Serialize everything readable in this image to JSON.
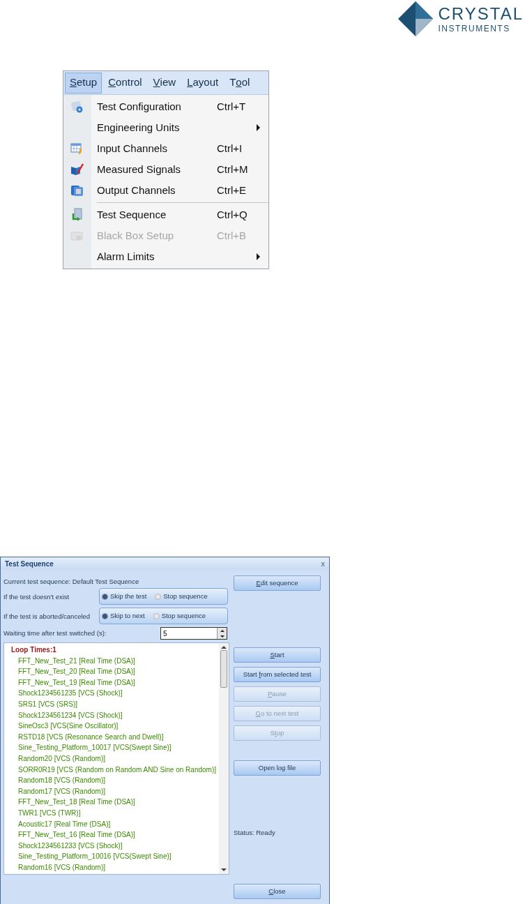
{
  "logo": {
    "line_1": "CRYSTAL",
    "line_2": "INSTRUMENTS"
  },
  "menu": {
    "bar": [
      {
        "label": {
          "key": "S",
          "after": "etup"
        },
        "selected": true
      },
      {
        "label": {
          "key": "C",
          "after": "ontrol"
        },
        "selected": false
      },
      {
        "label": {
          "key": "V",
          "after": "iew"
        },
        "selected": false
      },
      {
        "label": {
          "key": "L",
          "after": "ayout"
        },
        "selected": false
      },
      {
        "label": {
          "before": "T",
          "key": "o",
          "after": "ol"
        },
        "selected": false
      }
    ],
    "items": [
      {
        "label": "Test Configuration",
        "shortcut": "Ctrl+T",
        "submenu": false,
        "disabled": false
      },
      {
        "label": "Engineering Units",
        "submenu": true,
        "disabled": false
      },
      {
        "label": "Input Channels",
        "shortcut": "Ctrl+I",
        "submenu": false,
        "disabled": false
      },
      {
        "label": "Measured Signals",
        "shortcut": "Ctrl+M",
        "submenu": false,
        "disabled": false
      },
      {
        "label": "Output Channels",
        "shortcut": "Ctrl+E",
        "submenu": false,
        "disabled": false,
        "separator_after": true
      },
      {
        "label": "Test Sequence",
        "shortcut": "Ctrl+Q",
        "submenu": false,
        "disabled": false
      },
      {
        "label": "Black Box Setup",
        "shortcut": "Ctrl+B",
        "submenu": false,
        "disabled": true
      },
      {
        "label": "Alarm Limits",
        "submenu": true,
        "disabled": false
      }
    ]
  },
  "dialog": {
    "title": "Test Sequence",
    "close": "x",
    "current": "Current test sequence: Default Test Sequence",
    "options": [
      {
        "label": "If the test doesn't exist",
        "choices": [
          {
            "label": "Skip the test",
            "selected": true
          },
          {
            "label": "Stop sequence",
            "selected": false
          }
        ]
      },
      {
        "label": "If the test is aborted/canceled",
        "choices": [
          {
            "label": "Skip to next",
            "selected": true
          },
          {
            "label": "Stop sequence",
            "selected": false
          }
        ]
      }
    ],
    "waiting": {
      "label": "Waiting time after test switched (s):",
      "value": "5"
    },
    "list": [
      {
        "kind": "header",
        "text": "Loop Times:1"
      },
      {
        "kind": "test",
        "text": "FFT_New_Test_21 [Real Time (DSA)]"
      },
      {
        "kind": "test",
        "text": "FFT_New_Test_20 [Real Time (DSA)]"
      },
      {
        "kind": "test",
        "text": "FFT_New_Test_19 [Real Time (DSA)]"
      },
      {
        "kind": "test",
        "text": "Shock1234561235 [VCS (Shock)]"
      },
      {
        "kind": "test",
        "text": "SRS1 [VCS (SRS)]"
      },
      {
        "kind": "test",
        "text": "Shock1234561234 [VCS (Shock)]"
      },
      {
        "kind": "test",
        "text": "SineOsc3 [VCS(Sine Oscillator)]"
      },
      {
        "kind": "test",
        "text": "RSTD18 [VCS (Resonance Search and Dwell)]"
      },
      {
        "kind": "test",
        "text": "Sine_Testing_Platform_10017 [VCS(Swept Sine)]"
      },
      {
        "kind": "test",
        "text": "Random20 [VCS (Random)]"
      },
      {
        "kind": "test",
        "text": "SORR0R19 [VCS (Random on Random AND Sine on Random)]"
      },
      {
        "kind": "test",
        "text": "Random18 [VCS (Random)]"
      },
      {
        "kind": "test",
        "text": "Random17 [VCS (Random)]"
      },
      {
        "kind": "test",
        "text": "FFT_New_Test_18 [Real Time (DSA)]"
      },
      {
        "kind": "test",
        "text": "TWR1 [VCS (TWR)]"
      },
      {
        "kind": "test",
        "text": "Acoustic17 [Real Time (DSA)]"
      },
      {
        "kind": "test",
        "text": "FFT_New_Test_16 [Real Time (DSA)]"
      },
      {
        "kind": "test",
        "text": "Shock1234561233 [VCS (Shock)]"
      },
      {
        "kind": "test",
        "text": "Sine_Testing_Platform_10016 [VCS(Swept Sine)]"
      },
      {
        "kind": "test",
        "text": "Random16 [VCS (Random)]"
      }
    ],
    "edit_button": {
      "label": {
        "key": "E",
        "after": "dit sequence"
      },
      "disabled": false
    },
    "run_buttons": [
      {
        "label": {
          "key": "S",
          "after": "tart"
        },
        "disabled": false
      },
      {
        "label": {
          "before": "Start ",
          "key": "f",
          "after": "rom selected test"
        },
        "disabled": false
      },
      {
        "label": {
          "key": "P",
          "after": "ause"
        },
        "disabled": true
      },
      {
        "label": {
          "key": "G",
          "after": "o to next test"
        },
        "disabled": true
      },
      {
        "label": {
          "before": "S",
          "key": "t",
          "after": "op"
        },
        "disabled": true
      }
    ],
    "log_button": {
      "label": {
        "before": "Open log file"
      },
      "disabled": false
    },
    "status": "Status: Ready",
    "close_button": {
      "label": {
        "key": "C",
        "after": "lose"
      },
      "disabled": false
    }
  }
}
